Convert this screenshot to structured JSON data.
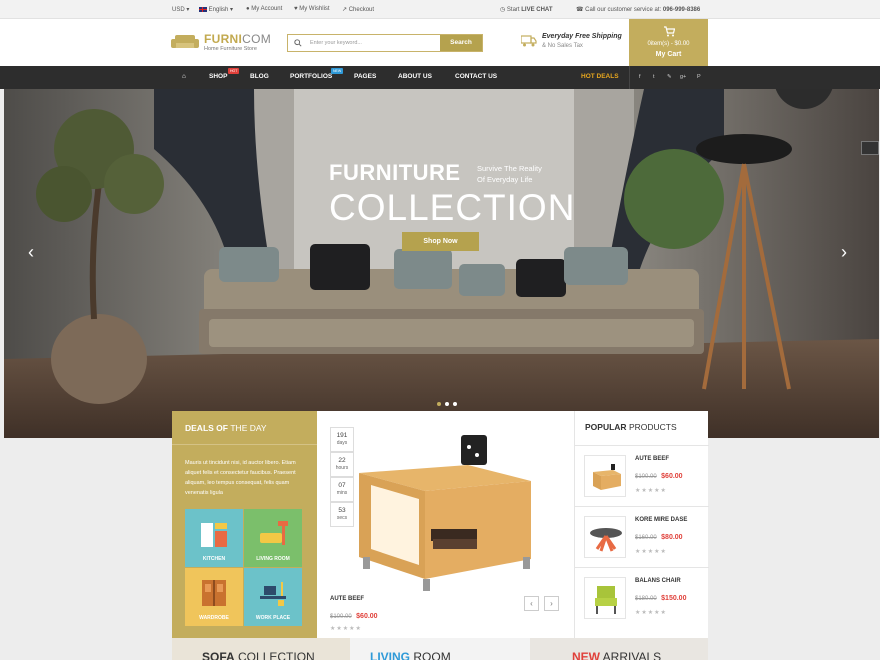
{
  "topbar": {
    "currency": "USD",
    "language": "English",
    "account": "My Account",
    "wishlist": "My Wishlist",
    "checkout": "Checkout",
    "start": "Start",
    "live_chat": "LIVE CHAT",
    "call_text": "Call our customer service at:",
    "phone": "096-999-8386"
  },
  "logo": {
    "name_a": "FURNI",
    "name_b": "COM",
    "tagline": "Home Furniture Store"
  },
  "search": {
    "placeholder": "Enter your keyword...",
    "button": "Search"
  },
  "shipping": {
    "title": "Everyday Free Shipping",
    "subtitle": "& No Sales Tax"
  },
  "cart": {
    "summary": "0item(s) - $0.00",
    "label": "My Cart"
  },
  "nav": {
    "items": [
      "SHOP",
      "BLOG",
      "PORTFOLIOS",
      "PAGES",
      "ABOUT US",
      "CONTACT US"
    ],
    "badge_hot": "HOT",
    "badge_new": "NEW",
    "hot_deals": "HOT DEALS",
    "social": [
      "f",
      "t",
      "✎",
      "g+",
      "P"
    ]
  },
  "slider": {
    "title_top": "FURNITURE",
    "subtitle_1": "Survive The Reality",
    "subtitle_2": "Of Everyday Life",
    "title_main": "COLLECTION",
    "button": "Shop Now"
  },
  "deals": {
    "title_bold": "DEALS OF",
    "title_rest": "THE DAY",
    "description": "Mauris ut tincidunt nisi, id auctor libero. Etiam aliquet felis et consectetur faucibus. Praesent aliquam, leo tempus consequat, felis quam venenatis ligula",
    "categories": [
      "KITCHEN",
      "LIVING ROOM",
      "WARDROBE",
      "WORK PLACE"
    ]
  },
  "countdown": [
    {
      "value": "191",
      "unit": "days"
    },
    {
      "value": "22",
      "unit": "hours"
    },
    {
      "value": "07",
      "unit": "mins"
    },
    {
      "value": "53",
      "unit": "secs"
    }
  ],
  "featured": {
    "name": "AUTE BEEF",
    "old_price": "$100.00",
    "new_price": "$60.00",
    "stars": "★★★★★"
  },
  "popular": {
    "title_bold": "POPULAR",
    "title_rest": "PRODUCTS",
    "products": [
      {
        "name": "AUTE BEEF",
        "old_price": "$100.00",
        "new_price": "$60.00",
        "stars": "★★★★★"
      },
      {
        "name": "KORE MIRE DASE",
        "old_price": "$160.00",
        "new_price": "$80.00",
        "stars": "★★★★★"
      },
      {
        "name": "BALANS CHAIR",
        "old_price": "$180.00",
        "new_price": "$150.00",
        "stars": "★★★★★"
      }
    ]
  },
  "collections": [
    {
      "bold": "SOFA",
      "rest": "COLLECTION"
    },
    {
      "bold": "LIVING",
      "rest": "ROOM"
    },
    {
      "bold": "NEW",
      "rest": "ARRIVALS"
    }
  ],
  "colors": {
    "accent": "#c3ad5d",
    "nav": "#2d2d2d",
    "price": "#e0403a",
    "hot": "#e6a61e"
  }
}
